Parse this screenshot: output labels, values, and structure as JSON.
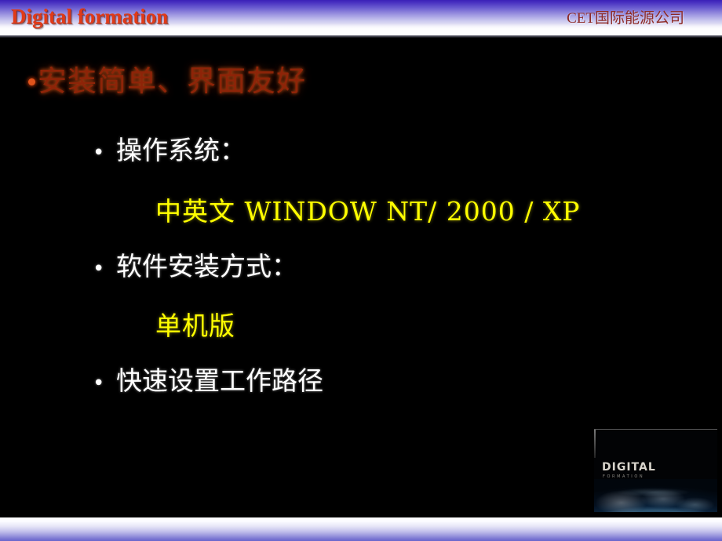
{
  "header": {
    "title": "Digital formation",
    "company": "CET国际能源公司",
    "title_color": "#e03a18",
    "company_color": "#8d2a26"
  },
  "slide": {
    "background_color": "#000000",
    "level1_bullet": {
      "marker": "•",
      "text": "安装简单、界面友好",
      "color": "#8e2408"
    },
    "items": [
      {
        "marker": "•",
        "label": "操作系统：",
        "color": "#ffffff",
        "detail": "中英文 WINDOW NT/ 2000 / XP",
        "detail_color": "#ffff00"
      },
      {
        "marker": "•",
        "label": "软件安装方式：",
        "color": "#ffffff",
        "detail": "单机版",
        "detail_color": "#ffff00"
      },
      {
        "marker": "•",
        "label": "快速设置工作路径",
        "color": "#ffffff",
        "detail": "",
        "detail_color": "#ffff00"
      }
    ]
  },
  "logo": {
    "brand": "DIGITAL",
    "sub": "FORMATION",
    "image_name": "earth-horizon-photo"
  },
  "footer": {
    "gradient_top": "#ffffff",
    "gradient_bottom": "#6a66cc"
  }
}
